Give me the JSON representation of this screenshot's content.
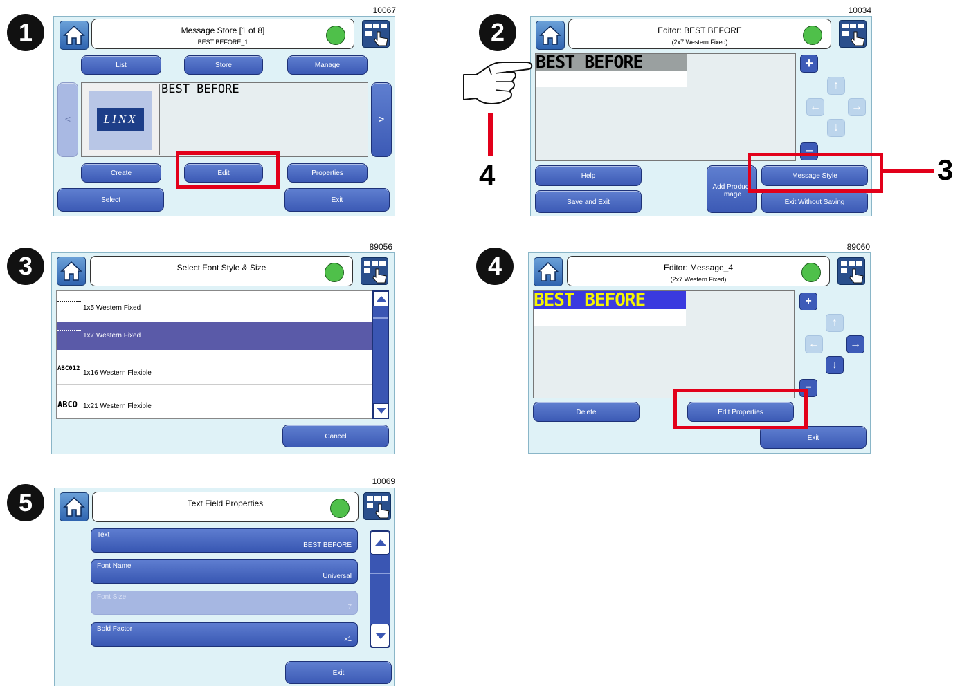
{
  "panel1": {
    "ref": "10067",
    "step": "1",
    "title": "Message Store [1 of 8]",
    "subtitle": "BEST BEFORE_1",
    "tabs": [
      "List",
      "Store",
      "Manage"
    ],
    "preview_text": "BEST BEFORE",
    "logo": "LINX",
    "prev": "<",
    "next": ">",
    "buttons": {
      "create": "Create",
      "edit": "Edit",
      "properties": "Properties",
      "select": "Select",
      "exit": "Exit"
    }
  },
  "panel2": {
    "ref": "10034",
    "step": "2",
    "title": "Editor: BEST BEFORE",
    "subtitle": "(2x7 Western Fixed)",
    "text": "BEST BEFORE",
    "buttons": {
      "help": "Help",
      "save_exit": "Save and Exit",
      "add_product_image": "Add Product Image",
      "message_style": "Message Style",
      "exit_without_saving": "Exit Without Saving"
    },
    "callout_3": "3",
    "callout_4": "4"
  },
  "panel3": {
    "ref": "89056",
    "step": "3",
    "title": "Select Font Style & Size",
    "rows": [
      {
        "label": "1x5 Western Fixed",
        "sample": ""
      },
      {
        "label": "1x7 Western Fixed",
        "sample": ""
      },
      {
        "label": "1x16 Western Flexible",
        "sample": "ABC012"
      },
      {
        "label": "1x21 Western Flexible",
        "sample": "ABCO"
      }
    ],
    "cancel": "Cancel"
  },
  "panel4": {
    "ref": "89060",
    "step": "4",
    "title": "Editor: Message_4",
    "subtitle": "(2x7 Western Fixed)",
    "text": "BEST BEFORE",
    "buttons": {
      "delete": "Delete",
      "edit_properties": "Edit Properties",
      "exit": "Exit"
    }
  },
  "panel5": {
    "ref": "10069",
    "step": "5",
    "title": "Text Field Properties",
    "fields": [
      {
        "label": "Text",
        "value": "BEST BEFORE"
      },
      {
        "label": "Font Name",
        "value": "Universal"
      },
      {
        "label": "Font Size",
        "value": "7"
      },
      {
        "label": "Bold Factor",
        "value": "x1"
      }
    ],
    "exit": "Exit"
  },
  "colors": {
    "highlight": "#e2001a",
    "button": "#3c5ab5",
    "led": "#4fc04a",
    "panel": "#dff2f7",
    "selected_row": "#5a5aa8",
    "yellow_text": "#f5f500"
  }
}
